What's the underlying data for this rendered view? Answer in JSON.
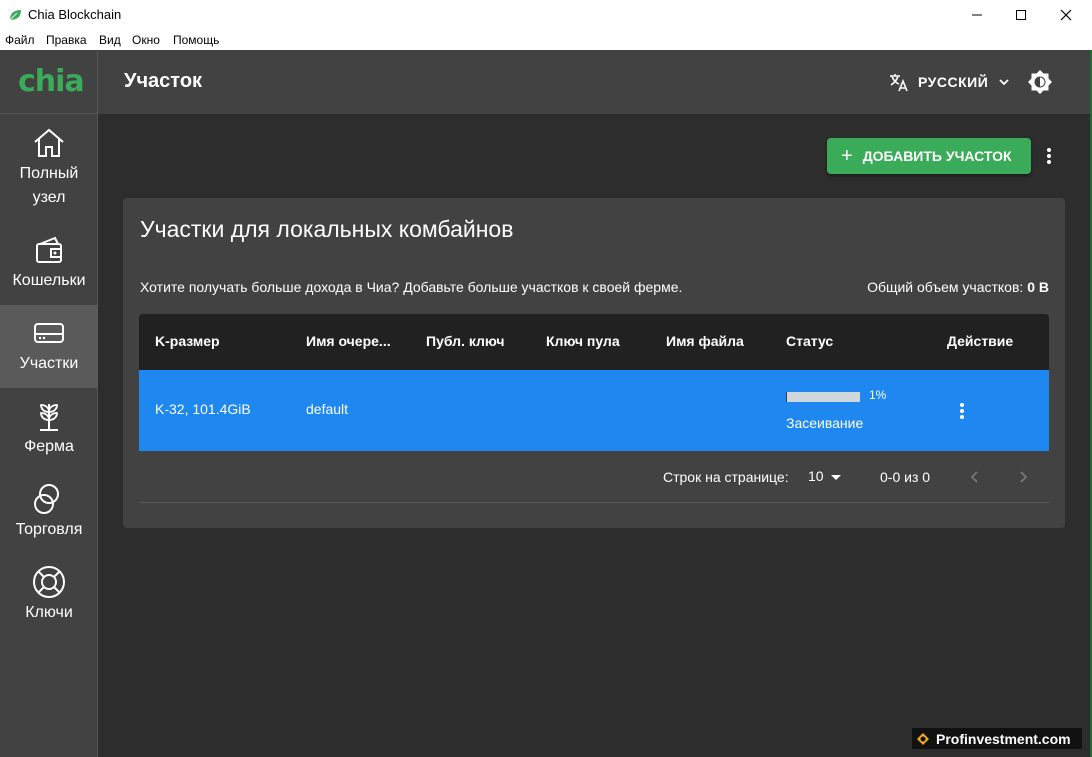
{
  "window": {
    "title": "Chia Blockchain"
  },
  "menu": [
    "Файл",
    "Правка",
    "Вид",
    "Окно",
    "Помощь"
  ],
  "logo": "chia",
  "sidebar": {
    "items": [
      {
        "label_line1": "Полный",
        "label_line2": "узел",
        "icon": "home-icon"
      },
      {
        "label": "Кошельки",
        "icon": "wallet-icon"
      },
      {
        "label": "Участки",
        "icon": "harddrive-icon",
        "active": true
      },
      {
        "label": "Ферма",
        "icon": "plant-icon"
      },
      {
        "label": "Торговля",
        "icon": "trade-icon"
      },
      {
        "label": "Ключи",
        "icon": "lifebuoy-icon"
      }
    ]
  },
  "header": {
    "title": "Участок",
    "language": "РУССКИЙ"
  },
  "actions": {
    "add_plot": "ДОБАВИТЬ УЧАСТОК"
  },
  "card": {
    "title": "Участки для локальных комбайнов",
    "description": "Хотите получать больше дохода в Чиа? Добавьте больше участков к своей ферме.",
    "total_label": "Общий объем участков:",
    "total_value": "0 B"
  },
  "table": {
    "columns": [
      "K-размер",
      "Имя очере...",
      "Публ. ключ",
      "Ключ пула",
      "Имя файла",
      "Статус",
      "Действие"
    ],
    "rows": [
      {
        "k_size": "K-32, 101.4GiB",
        "queue": "default",
        "public_key": "",
        "pool_key": "",
        "filename": "",
        "progress_percent": 1,
        "progress_label": "1%",
        "status": "Засеивание"
      }
    ]
  },
  "pagination": {
    "rows_per_page_label": "Строк на странице:",
    "rows_per_page": "10",
    "range": "0-0 из 0"
  },
  "watermark": "Profinvestment.com",
  "colors": {
    "accent": "#3aac59",
    "selected_row": "#1e88f0",
    "background": "#2d2d2d",
    "panel": "#424242"
  }
}
